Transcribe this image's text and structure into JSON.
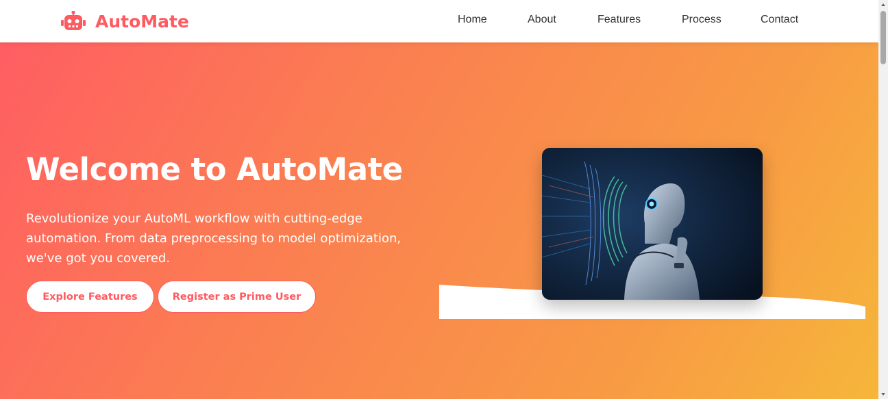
{
  "brand": {
    "name": "AutoMate",
    "icon": "robot-icon",
    "color": "#ff5a5f"
  },
  "nav": {
    "links": [
      {
        "label": "Home"
      },
      {
        "label": "About"
      },
      {
        "label": "Features"
      },
      {
        "label": "Process"
      },
      {
        "label": "Contact"
      }
    ]
  },
  "hero": {
    "title": "Welcome to AutoMate",
    "subtitle_lines": [
      "Revolutionize your AutoML workflow with cutting-edge",
      "automation. From data preprocessing to model optimization,",
      "we've got you covered."
    ],
    "buttons": {
      "explore": "Explore Features",
      "prime": "Register as Prime User"
    },
    "image": {
      "description_icon": "ai-robot-image"
    },
    "gradient": {
      "from": "#ff5e62",
      "to": "#f6b63a"
    }
  },
  "scrollbar": {
    "up_icon": "chevron-up-icon",
    "down_icon": "chevron-down-icon"
  }
}
